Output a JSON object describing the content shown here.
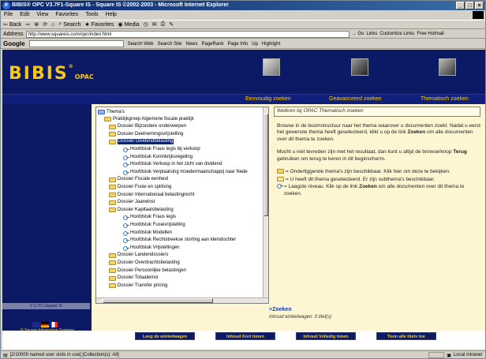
{
  "window": {
    "title": "BIBIS® OPC V3.7F1-Square IS - Square IS ©2002-2003 - Microsoft Internet Explorer"
  },
  "menu": [
    "File",
    "Edit",
    "View",
    "Favorites",
    "Tools",
    "Help"
  ],
  "toolbar": {
    "back": "Back",
    "search": "Search",
    "favorites": "Favorites",
    "media": "Media"
  },
  "address": {
    "label": "Address",
    "url": "http://www.squareis.com/opc/index.html",
    "go": "Go",
    "links": "Links",
    "customize": "Customize Links",
    "hotmail": "Free Hotmail"
  },
  "google": {
    "logo": "Google",
    "search_web": "Search Web",
    "search_site": "Search Site",
    "news": "News",
    "pagerank": "PageRank",
    "pageinfo": "Page Info",
    "up": "Up",
    "highlight": "Highlight"
  },
  "colors": {
    "banner": "#0c1a66",
    "accent": "#f5c518",
    "cream": "#fef6d2"
  },
  "banner": {
    "logo": "BIBIS",
    "logo_sub": "OPAC",
    "reg": "®"
  },
  "nav": {
    "simple": "Eenvoudig zoeken",
    "advanced": "Geavanceerd zoeken",
    "thematic": "Thematisch zoeken"
  },
  "sidebar": {
    "version": "V 3.7F1-Square IS",
    "company": "© Square Information Systems"
  },
  "tree": {
    "root": "Thema's",
    "nodes": [
      {
        "label": "Praktijkgroep Algemene fiscale praktijk",
        "type": "folder",
        "level": 1
      },
      {
        "label": "Dossier Bijzondere onderwerpen",
        "type": "folder",
        "level": 2
      },
      {
        "label": "Dossier Deelnemingsvrijstelling",
        "type": "folder",
        "level": 2
      },
      {
        "label": "Dossier Dividendbelasting",
        "type": "folder",
        "level": 2,
        "selected": true
      },
      {
        "label": "Hoofdstuk Fraus legis bij verkoop",
        "type": "leaf",
        "level": 3
      },
      {
        "label": "Hoofdstuk Koninkrijksregeling",
        "type": "leaf",
        "level": 3
      },
      {
        "label": "Hoofdstuk Verkoop in het zicht van dividend",
        "type": "leaf",
        "level": 3
      },
      {
        "label": "Hoofdstuk Verplaatsing moedermaatschappij naar Nede",
        "type": "leaf",
        "level": 3
      },
      {
        "label": "Dossier Fiscale eenheid",
        "type": "folder",
        "level": 2
      },
      {
        "label": "Dossier Fusie en splitsing",
        "type": "folder",
        "level": 2
      },
      {
        "label": "Dossier Internationaal belastingrecht",
        "type": "folder",
        "level": 2
      },
      {
        "label": "Dossier Jaarwinst",
        "type": "folder",
        "level": 2
      },
      {
        "label": "Dossier Kapitaalsbelasting",
        "type": "folder",
        "level": 2
      },
      {
        "label": "Hoofdstuk Fraus legis",
        "type": "leaf",
        "level": 3
      },
      {
        "label": "Hoofdstuk Fusievrijstelling",
        "type": "leaf",
        "level": 3
      },
      {
        "label": "Hoofdstuk Modellen",
        "type": "leaf",
        "level": 3
      },
      {
        "label": "Hoofdstuk Rechtstreekse storting aan kleindochter",
        "type": "leaf",
        "level": 3
      },
      {
        "label": "Hoofdstuk Vrijstellingen",
        "type": "leaf",
        "level": 3
      },
      {
        "label": "Dossier Landendossiers",
        "type": "folder",
        "level": 2
      },
      {
        "label": "Dossier Overdrachtsbelasting",
        "type": "folder",
        "level": 2
      },
      {
        "label": "Dossier Persoonlijke belastingen",
        "type": "folder",
        "level": 2
      },
      {
        "label": "Dossier Totaalwinst",
        "type": "folder",
        "level": 2
      },
      {
        "label": "Dossier Transfer pricing",
        "type": "folder",
        "level": 2
      }
    ]
  },
  "info": {
    "heading": "Welkom bij OPAC Thematisch zoeken",
    "p1a": "Browse in de boomstructuur naar het thema waarover u documenten zoekt. Nadat u eerst het gewenste thema heeft geselecteerd, klikt u op de link ",
    "p1b": "Zoeken",
    "p1c": " om alle documenten over dit thema te zoeken.",
    "p2a": "Mocht u niet tevreden zijn met het resultaat, dan kunt u altijd de browserknop ",
    "p2b": "Terug",
    "p2c": " gebruiken om terug te keren in dit beginscherm.",
    "legend1": "= Onderliggende thema's zijn beschikbaar. Klik hier om deze te bekijken.",
    "legend2": "= U heeft dit thema geselecteerd. Er zijn subthema's beschikbaar.",
    "legend3a": "= Laagste niveau. Klik op de link ",
    "legend3b": "Zoeken",
    "legend3c": " om alle documenten over dit thema te zoeken."
  },
  "zoeken": ">Zoeken",
  "cart": "Inhoud winkelwagen: 0 titel(s)",
  "buttons": {
    "empty": "Leeg de winkelwagen",
    "short": "Inhoud Kort tonen",
    "full": "Inhoud Volledig tonen",
    "all": "Toon alle titels toe"
  },
  "status": {
    "text": "[2/10000 named user slots in use] [Collection(s): All]",
    "zone": "Local intranet"
  }
}
